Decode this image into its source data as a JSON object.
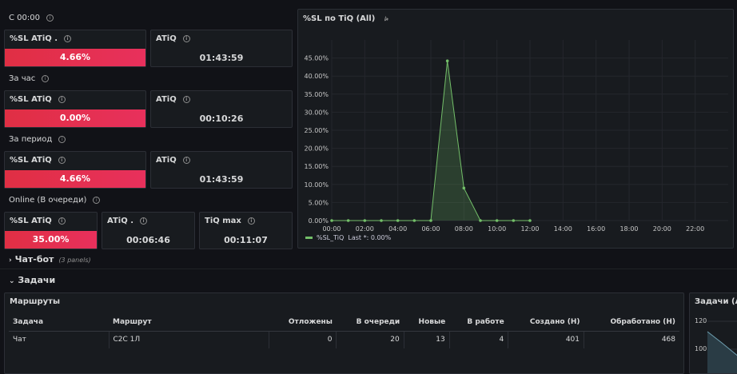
{
  "sections": {
    "since_midnight": "С 00:00",
    "last_hour": "За час",
    "period": "За период",
    "online": "Online (В очереди)"
  },
  "stats": {
    "s1": {
      "sl_title": "%SL ATiQ .",
      "sl_value": "4.66%",
      "atiq_title": "ATiQ",
      "atiq_value": "01:43:59"
    },
    "s2": {
      "sl_title": "%SL ATiQ",
      "sl_value": "0.00%",
      "atiq_title": "ATiQ",
      "atiq_value": "00:10:26"
    },
    "s3": {
      "sl_title": "%SL ATiQ",
      "sl_value": "4.66%",
      "atiq_title": "ATiQ",
      "atiq_value": "01:43:59"
    },
    "s4": {
      "sl_title": "%SL ATiQ",
      "sl_value": "35.00%",
      "atiq_title": "ATiQ .",
      "atiq_value": "00:06:46",
      "tiqmax_title": "TiQ max",
      "tiqmax_value": "00:11:07"
    }
  },
  "graph": {
    "title": "%SL по TiQ (All)",
    "legend_name": "%SL_TiQ",
    "legend_stat": "Last *: 0.00%",
    "colors": {
      "line": "#73bf69"
    }
  },
  "chart_data": {
    "type": "area",
    "x": [
      "00:00",
      "01:00",
      "02:00",
      "03:00",
      "04:00",
      "05:00",
      "06:00",
      "07:00",
      "08:00",
      "09:00",
      "10:00",
      "11:00",
      "12:00"
    ],
    "series": [
      {
        "name": "%SL_TiQ",
        "values": [
          0,
          0,
          0,
          0,
          0,
          0,
          0,
          44.2,
          9.0,
          0,
          0,
          0,
          0
        ]
      }
    ],
    "xticks": [
      "00:00",
      "02:00",
      "04:00",
      "06:00",
      "08:00",
      "10:00",
      "12:00",
      "14:00",
      "16:00",
      "18:00",
      "20:00",
      "22:00"
    ],
    "yticks": [
      "0.00%",
      "5.00%",
      "10.00%",
      "15.00%",
      "20.00%",
      "25.00%",
      "30.00%",
      "35.00%",
      "40.00%",
      "45.00%"
    ],
    "ylim": [
      0,
      50
    ],
    "xlim": [
      0,
      24
    ]
  },
  "rows": {
    "chatbot": "Чат-бот",
    "chatbot_note": "(3 panels)",
    "tasks": "Задачи"
  },
  "routes": {
    "title": "Маршруты",
    "headers": [
      "Задача",
      "Маршрут",
      "Отложены",
      "В очереди",
      "Новые",
      "В работе",
      "Создано (Н)",
      "Обработано (Н)"
    ],
    "row": [
      "Чат",
      "C2C 1Л",
      "0",
      "20",
      "13",
      "4",
      "401",
      "468"
    ]
  },
  "tasks_panel": {
    "title": "Задачи (All)",
    "ytick1": "120",
    "ytick2": "100"
  }
}
